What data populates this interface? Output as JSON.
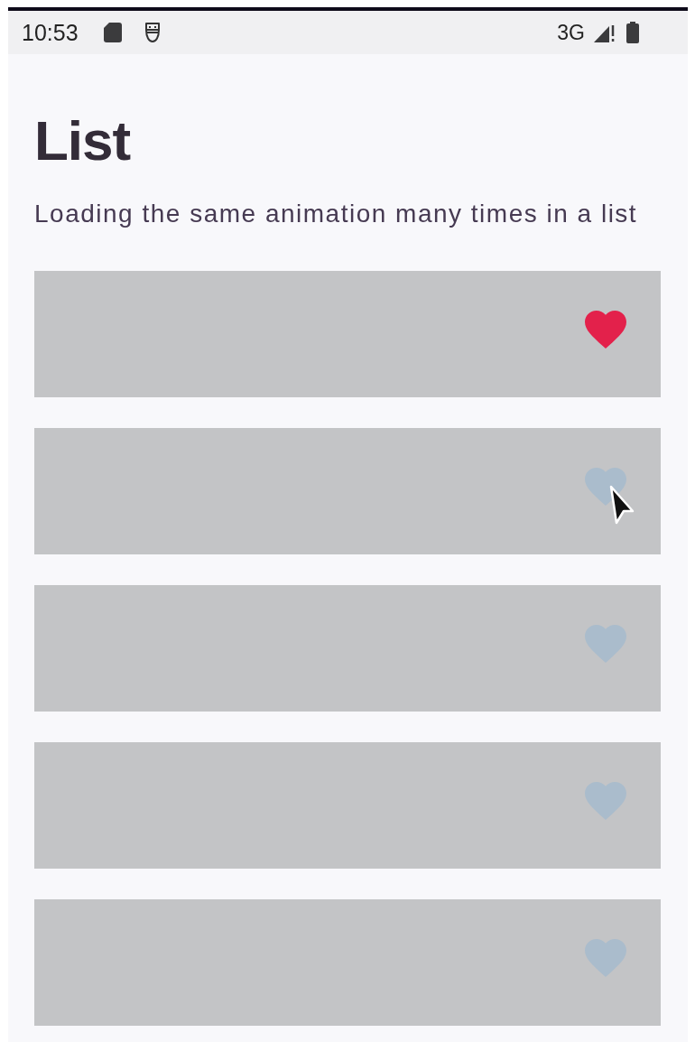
{
  "status_bar": {
    "time": "10:53",
    "network": "3G"
  },
  "page": {
    "title": "List",
    "subtitle": "Loading the same animation many times in a list"
  },
  "items": [
    {
      "liked": true
    },
    {
      "liked": false
    },
    {
      "liked": false
    },
    {
      "liked": false
    },
    {
      "liked": false
    }
  ]
}
